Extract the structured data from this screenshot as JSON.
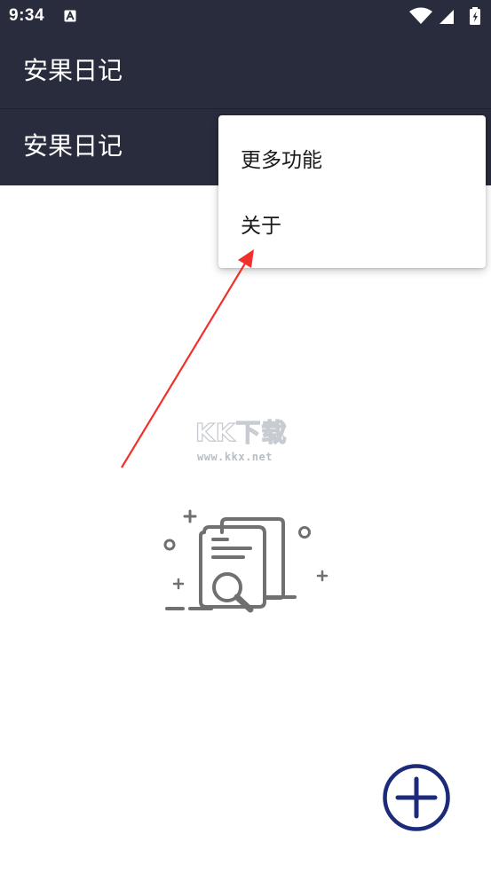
{
  "status_bar": {
    "time": "9:34",
    "notification_icon": "a-icon",
    "right_icons": [
      "wifi-icon",
      "signal-icon",
      "battery-icon"
    ]
  },
  "app_bar_top": {
    "title": "安果日记"
  },
  "app_bar": {
    "title": "安果日记"
  },
  "overflow_menu": {
    "items": [
      {
        "label": "更多功能"
      },
      {
        "label": "关于"
      }
    ]
  },
  "watermark": {
    "brand": "KK下载",
    "url": "www.kkx.net"
  },
  "empty_state": {
    "icon": "empty-document-search-icon"
  },
  "fab": {
    "icon": "plus-circle-icon"
  },
  "colors": {
    "app_bar": "#282c3c",
    "background": "#ffffff",
    "fab": "#1c2a7a",
    "annotation_arrow": "#f2302b",
    "illustration": "#707070"
  }
}
